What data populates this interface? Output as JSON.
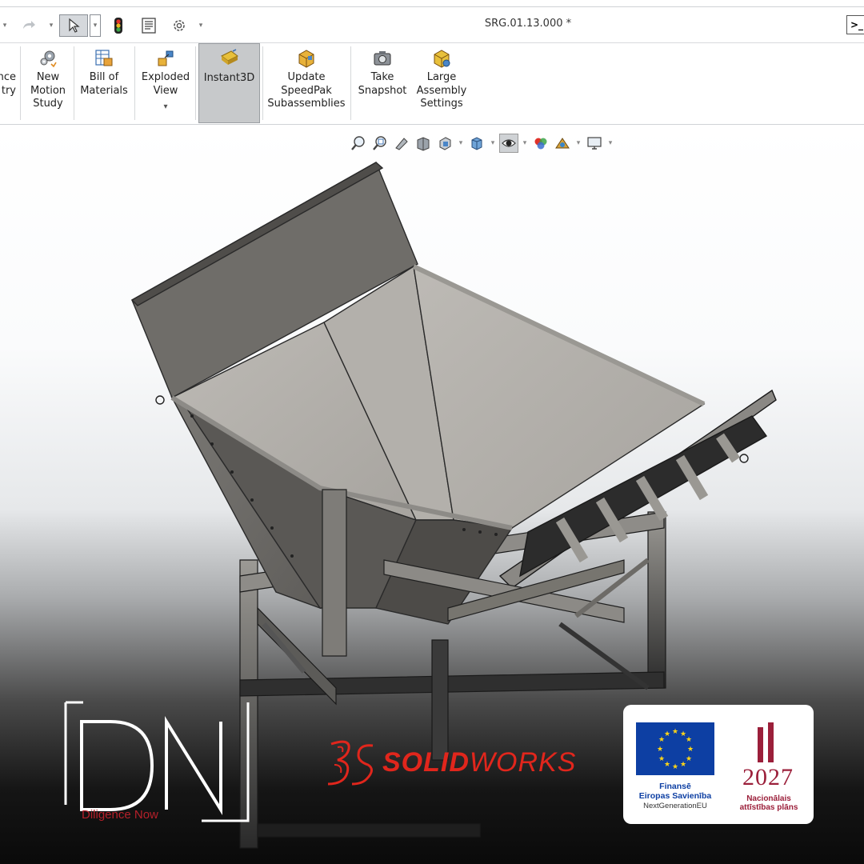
{
  "window": {
    "document_title": "SRG.01.13.000 *",
    "terminal_label": ">_"
  },
  "ribbon": {
    "partial_button_label": "nce\ntry",
    "buttons": [
      {
        "id": "new-motion-study",
        "label": "New\nMotion\nStudy",
        "icon": "motion-study-icon"
      },
      {
        "id": "bill-of-materials",
        "label": "Bill of\nMaterials",
        "icon": "bom-icon"
      },
      {
        "id": "exploded-view",
        "label": "Exploded\nView",
        "icon": "exploded-view-icon"
      },
      {
        "id": "instant3d",
        "label": "Instant3D",
        "icon": "instant3d-icon",
        "active": true
      },
      {
        "id": "update-speedpak",
        "label": "Update\nSpeedPak\nSubassemblies",
        "icon": "speedpak-icon"
      },
      {
        "id": "take-snapshot",
        "label": "Take\nSnapshot",
        "icon": "camera-icon"
      },
      {
        "id": "large-assembly-settings",
        "label": "Large\nAssembly\nSettings",
        "icon": "large-assembly-icon"
      }
    ],
    "exploded_caret": "▾"
  },
  "logos": {
    "dn_letters": "DN",
    "dn_tagline": "Diligence Now",
    "solidworks_bold": "SOLID",
    "solidworks_light": "WORKS",
    "eu_line1": "Finansē",
    "eu_line2": "Eiropas Savienība",
    "eu_line3": "NextGenerationEU",
    "np_year": "2027",
    "np_line1": "Nacionālais",
    "np_line2": "attīstības plāns"
  },
  "colors": {
    "brand_red": "#e1261c",
    "eu_blue": "#0d3fa3",
    "eu_star": "#ffd617",
    "np_maroon": "#9b1f3a"
  }
}
